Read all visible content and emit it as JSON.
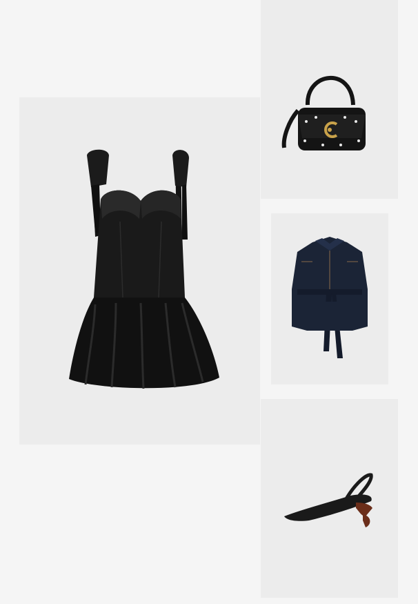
{
  "outfit": {
    "items": [
      {
        "id": "dress",
        "icon": "dress-image",
        "color": "#111111"
      },
      {
        "id": "bag",
        "icon": "handbag-image",
        "color": "#111111",
        "hardware_color": "#c9a24a"
      },
      {
        "id": "jacket",
        "icon": "jacket-image",
        "color": "#1b2436",
        "stitch_color": "#8a6a4a"
      },
      {
        "id": "pumps",
        "icon": "slingback-pump-image",
        "color": "#1a1a1a",
        "heel_color": "#6b2e1a"
      }
    ],
    "colors": {
      "page_background": "#f5f5f5",
      "tile_background": "#ececec"
    }
  }
}
